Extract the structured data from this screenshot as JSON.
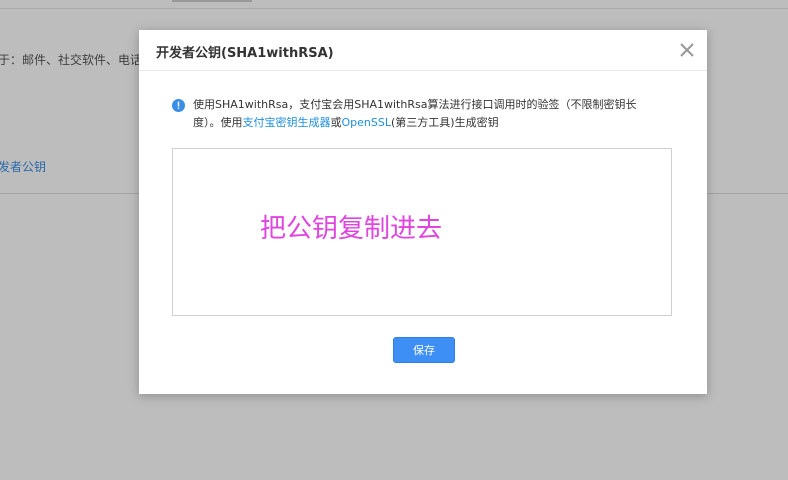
{
  "background": {
    "description_text": "于：邮件、社交软件、电话",
    "link_text": "发者公钥"
  },
  "modal": {
    "title": "开发者公钥(SHA1withRSA)",
    "close_icon": "close-icon",
    "info": {
      "icon": "info-icon",
      "text_before": "使用SHA1withRsa，支付宝会用SHA1withRsa算法进行接口调用时的验签（不限制密钥长度）。使用",
      "link1": "支付宝密钥生成器",
      "text_middle": "或",
      "link2": "OpenSSL",
      "text_after": "(第三方工具)生成密钥"
    },
    "textarea": {
      "value": "",
      "annotation": "把公钥复制进去"
    },
    "save_label": "保存"
  },
  "colors": {
    "accent": "#3d8ff5",
    "link": "#1e8ee0",
    "annotation": "#e045e0",
    "mask": "rgba(0,0,0,0.26)"
  }
}
